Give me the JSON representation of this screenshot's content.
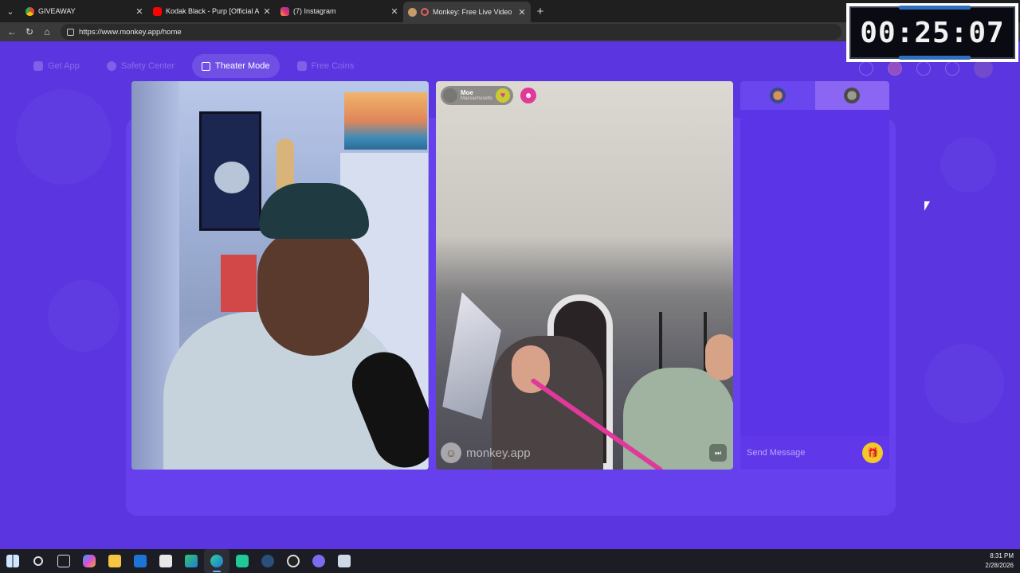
{
  "browser": {
    "tabs": [
      {
        "title": "GIVEAWAY",
        "favicon": "chrome-color-icon",
        "active": false
      },
      {
        "title": "Kodak Black - Purp [Official Audio]",
        "favicon": "youtube-icon",
        "active": false
      },
      {
        "title": "(7) Instagram",
        "favicon": "instagram-icon",
        "active": false
      },
      {
        "title": "Monkey: Free Live Video Chat",
        "favicon": "monkey-icon",
        "active": true
      }
    ],
    "url": "https://www.monkey.app/home"
  },
  "timer": {
    "value": "00:25:07"
  },
  "monkey": {
    "nav": [
      {
        "label": "Get App",
        "active": false
      },
      {
        "label": "Safety Center",
        "active": false
      },
      {
        "label": "Theater Mode",
        "active": true
      },
      {
        "label": "Free Coins",
        "active": false
      }
    ],
    "remote_user": {
      "name": "Moe",
      "location": "Massachusetts"
    },
    "watermark": "monkey.app",
    "chat": {
      "placeholder": "Send Message"
    }
  },
  "taskbar": {
    "time": "8:31 PM",
    "date": "2/28/2026"
  },
  "colors": {
    "page_bg": "#5a35e0",
    "accent_pink": "#e0399a",
    "gift_yellow": "#f3c92a"
  }
}
